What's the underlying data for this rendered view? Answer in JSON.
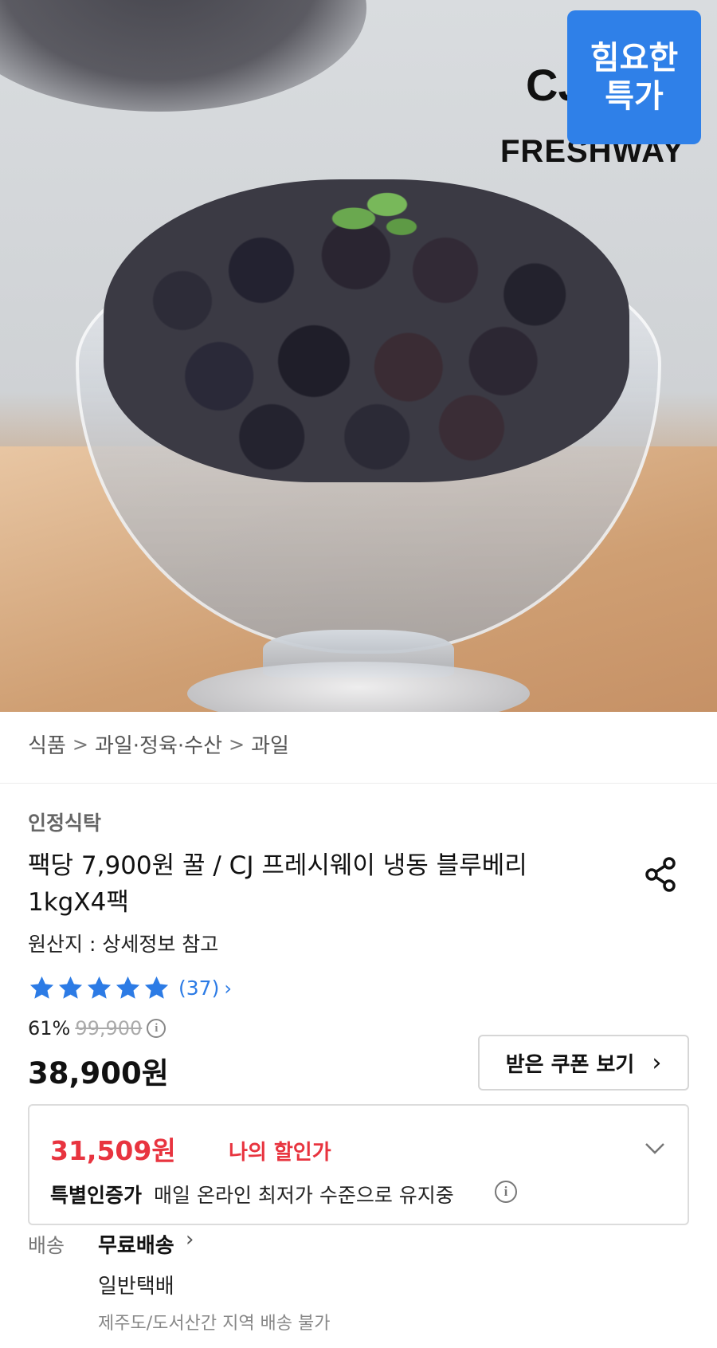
{
  "hero": {
    "brand_top": "CJ",
    "brand_name": "FRESHWAY",
    "badge_line1": "힘요한",
    "badge_line2": "특가"
  },
  "breadcrumb": {
    "items": [
      "식품",
      "과일·정육·수산",
      "과일"
    ],
    "separator": ">"
  },
  "product": {
    "seller": "인정식탁",
    "title": "팩당 7,900원 꿀 / CJ 프레시웨이 냉동 블루베리 1kgX4팩",
    "origin": "원산지 : 상세정보 참고",
    "rating_stars": 5,
    "review_count": "(37)",
    "discount_rate": "61%",
    "original_price": "99,900",
    "price": "38,900원"
  },
  "coupon": {
    "label": "받은 쿠폰 보기"
  },
  "my_discount": {
    "price": "31,509원",
    "label": "나의 할인가",
    "cert_label": "특별인증가",
    "cert_desc": "매일 온라인 최저가 수준으로 유지중"
  },
  "delivery": {
    "label": "배송",
    "type": "무료배송",
    "method": "일반택배",
    "note": "제주도/도서산간 지역 배송 불가"
  },
  "colors": {
    "accent_blue": "#2c7be5",
    "badge_blue": "#2f80e8",
    "discount_red": "#e8343f"
  }
}
